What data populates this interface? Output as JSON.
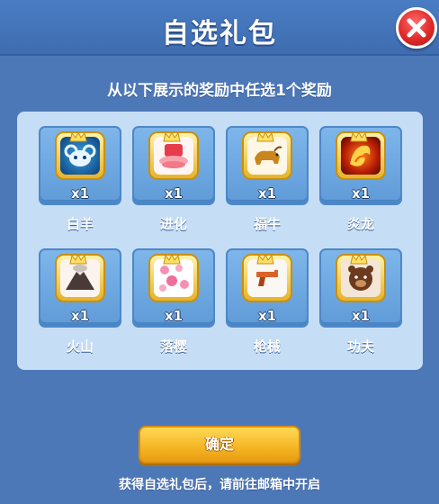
{
  "header": {
    "title": "自选礼包"
  },
  "panel": {
    "subtitle": "从以下展示的奖励中任选1个奖励",
    "items": [
      {
        "name": "白羊",
        "qty": "x1",
        "icon": "aries-mask-icon"
      },
      {
        "name": "进化",
        "qty": "x1",
        "icon": "evolution-jelly-icon"
      },
      {
        "name": "福牛",
        "qty": "x1",
        "icon": "lucky-ox-icon"
      },
      {
        "name": "炎龙",
        "qty": "x1",
        "icon": "flame-dragon-icon"
      },
      {
        "name": "火山",
        "qty": "x1",
        "icon": "volcano-icon"
      },
      {
        "name": "落樱",
        "qty": "x1",
        "icon": "cherry-blossom-icon"
      },
      {
        "name": "枪械",
        "qty": "x1",
        "icon": "gun-icon"
      },
      {
        "name": "功夫",
        "qty": "x1",
        "icon": "kungfu-bear-icon"
      }
    ],
    "confirm_label": "确定",
    "footnote": "获得自选礼包后，请前往邮箱中开启"
  },
  "colors": {
    "background": "#4d78b8",
    "header": "#4a7cc4",
    "grid_box": "#c5def5",
    "card": "#6fa8e2",
    "confirm": "#f5b423",
    "close": "#e02a2a"
  }
}
